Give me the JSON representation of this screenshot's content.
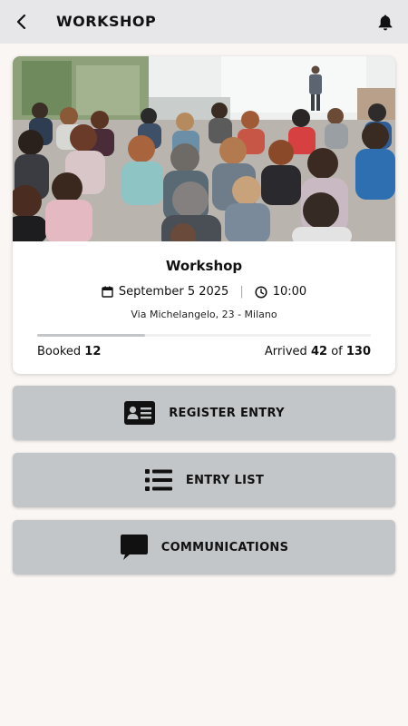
{
  "header": {
    "title": "WORKSHOP",
    "back_icon": "arrow-back-icon",
    "notification_icon": "bell-icon"
  },
  "event": {
    "name": "Workshop",
    "date": "September 5 2025",
    "time": "10:00",
    "date_separator": "|",
    "address": "Via Michelangelo, 23 - Milano",
    "booked_label": "Booked",
    "booked_count": "12",
    "arrived_label": "Arrived",
    "arrived_count": "42",
    "of_label": "of",
    "capacity": "130",
    "progress_fraction": 0.323
  },
  "actions": [
    {
      "label": "REGISTER ENTRY",
      "icon": "id-card-icon"
    },
    {
      "label": "ENTRY LIST",
      "icon": "list-icon"
    },
    {
      "label": "COMMUNICATIONS",
      "icon": "chat-bubble-icon"
    }
  ],
  "colors": {
    "header_bg": "#e7e7e9",
    "page_bg": "#faf6f4",
    "button_bg": "#c3c6c8"
  }
}
